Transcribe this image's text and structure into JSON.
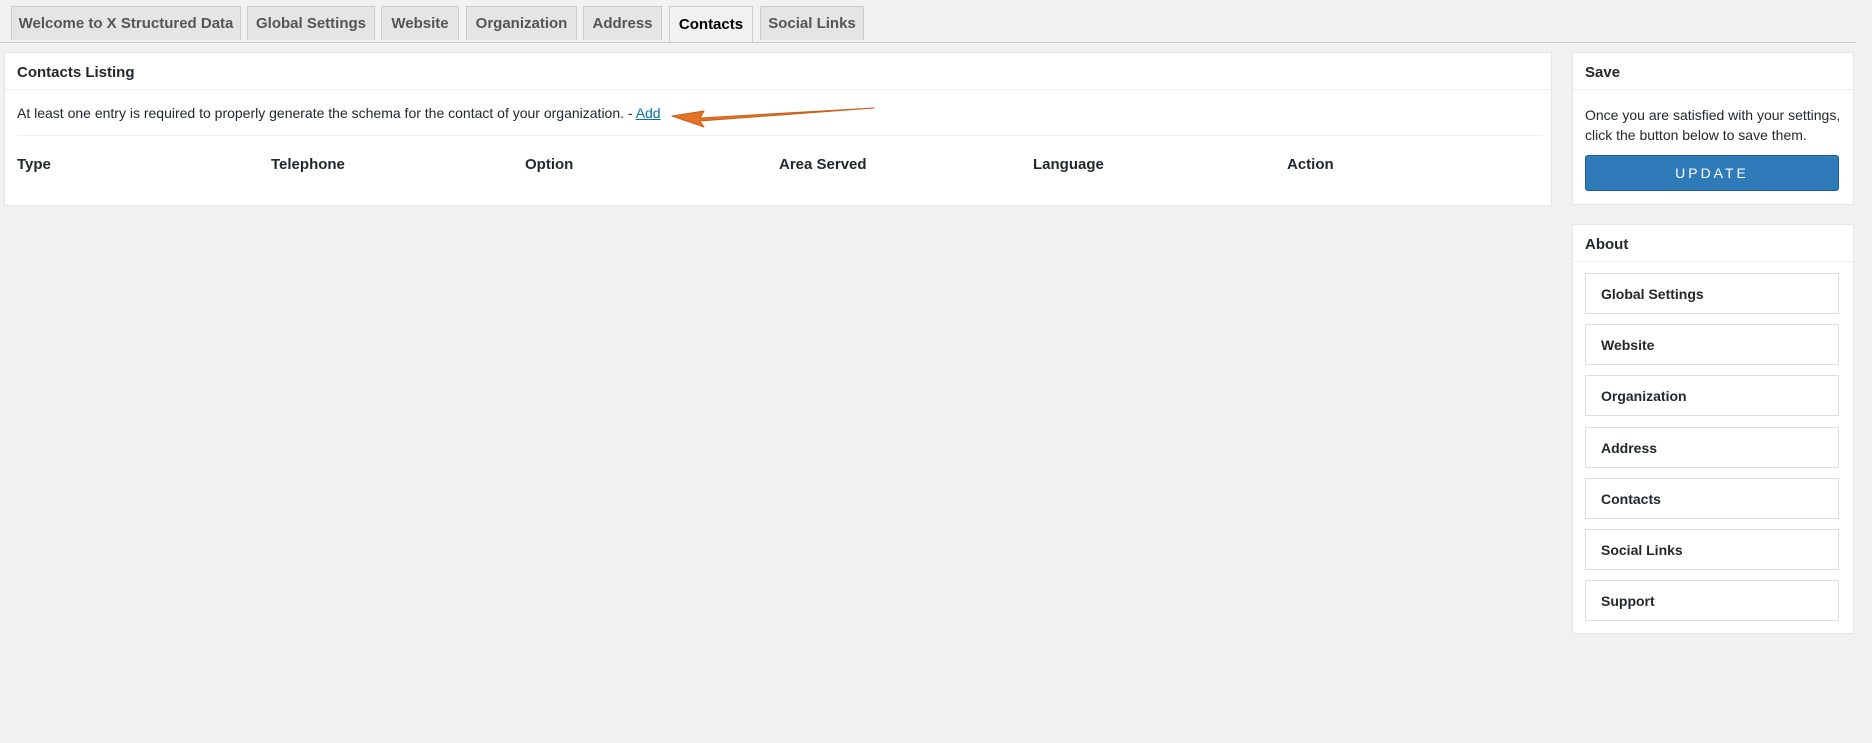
{
  "tabs": [
    {
      "label": "Welcome to X Structured Data",
      "active": false
    },
    {
      "label": "Global Settings",
      "active": false
    },
    {
      "label": "Website",
      "active": false
    },
    {
      "label": "Organization",
      "active": false
    },
    {
      "label": "Address",
      "active": false
    },
    {
      "label": "Contacts",
      "active": true
    },
    {
      "label": "Social Links",
      "active": false
    }
  ],
  "contacts": {
    "title": "Contacts Listing",
    "notice_text": "At least one entry is required to properly generate the schema for the contact of your organization. - ",
    "add_link": "Add",
    "columns": [
      "Type",
      "Telephone",
      "Option",
      "Area Served",
      "Language",
      "Action"
    ]
  },
  "save_box": {
    "title": "Save",
    "text": "Once you are satisfied with your settings, click the button below to save them.",
    "button_label": "UPDATE"
  },
  "about_box": {
    "title": "About",
    "items": [
      "Global Settings",
      "Website",
      "Organization",
      "Address",
      "Contacts",
      "Social Links",
      "Support"
    ]
  },
  "colors": {
    "arrow": "#e27326",
    "button": "#2f7ab8",
    "link": "#0073aa",
    "background": "#f1f1f1"
  },
  "icons": {
    "annotation": "arrow-left-icon"
  }
}
